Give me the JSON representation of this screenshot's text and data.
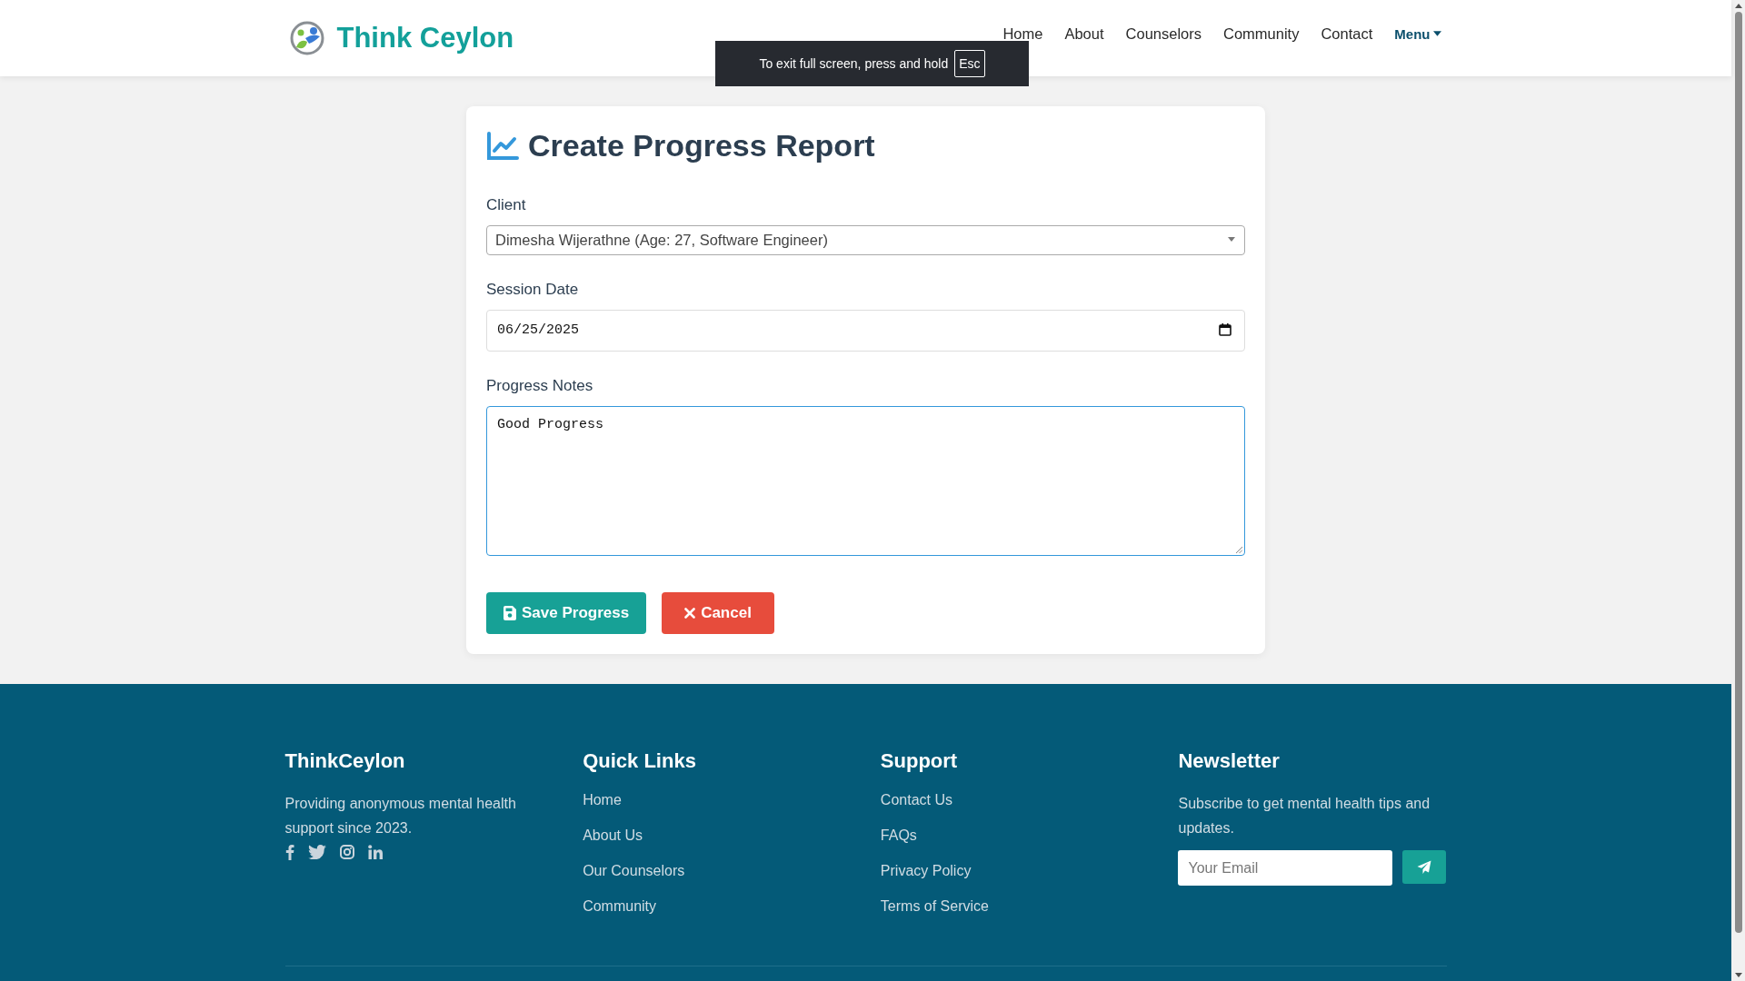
{
  "header": {
    "logo_text": "Think Ceylon",
    "nav": [
      {
        "label": "Home"
      },
      {
        "label": "About"
      },
      {
        "label": "Counselors"
      },
      {
        "label": "Community"
      },
      {
        "label": "Contact"
      }
    ],
    "menu": {
      "label": "Menu"
    }
  },
  "fullscreen_notice": {
    "text": "To exit full screen, press and hold",
    "key": "Esc"
  },
  "form": {
    "title": "Create Progress Report",
    "fields": [
      {
        "kind": "select",
        "label": "Client",
        "value": "Dimesha Wijerathne (Age: 27, Software Engineer)",
        "focused": false
      },
      {
        "kind": "date",
        "label": "Session Date",
        "value": "06/25/2025",
        "focused": false
      },
      {
        "kind": "textarea",
        "label": "Progress Notes",
        "value": "Good Progress",
        "focused": true
      }
    ],
    "buttons": [
      {
        "kind": "save",
        "label": "Save Progress"
      },
      {
        "kind": "cancel",
        "label": "Cancel"
      }
    ]
  },
  "footer": {
    "brand": {
      "title": "ThinkCeylon",
      "text": "Providing anonymous mental health support since 2023."
    },
    "columns": [
      {
        "title": "Quick Links",
        "links": [
          "Home",
          "About Us",
          "Our Counselors",
          "Community"
        ]
      },
      {
        "title": "Support",
        "links": [
          "Contact Us",
          "FAQs",
          "Privacy Policy",
          "Terms of Service"
        ]
      }
    ],
    "newsletter": {
      "title": "Newsletter",
      "text": "Subscribe to get mental health tips and updates.",
      "placeholder": "Your Email"
    }
  }
}
